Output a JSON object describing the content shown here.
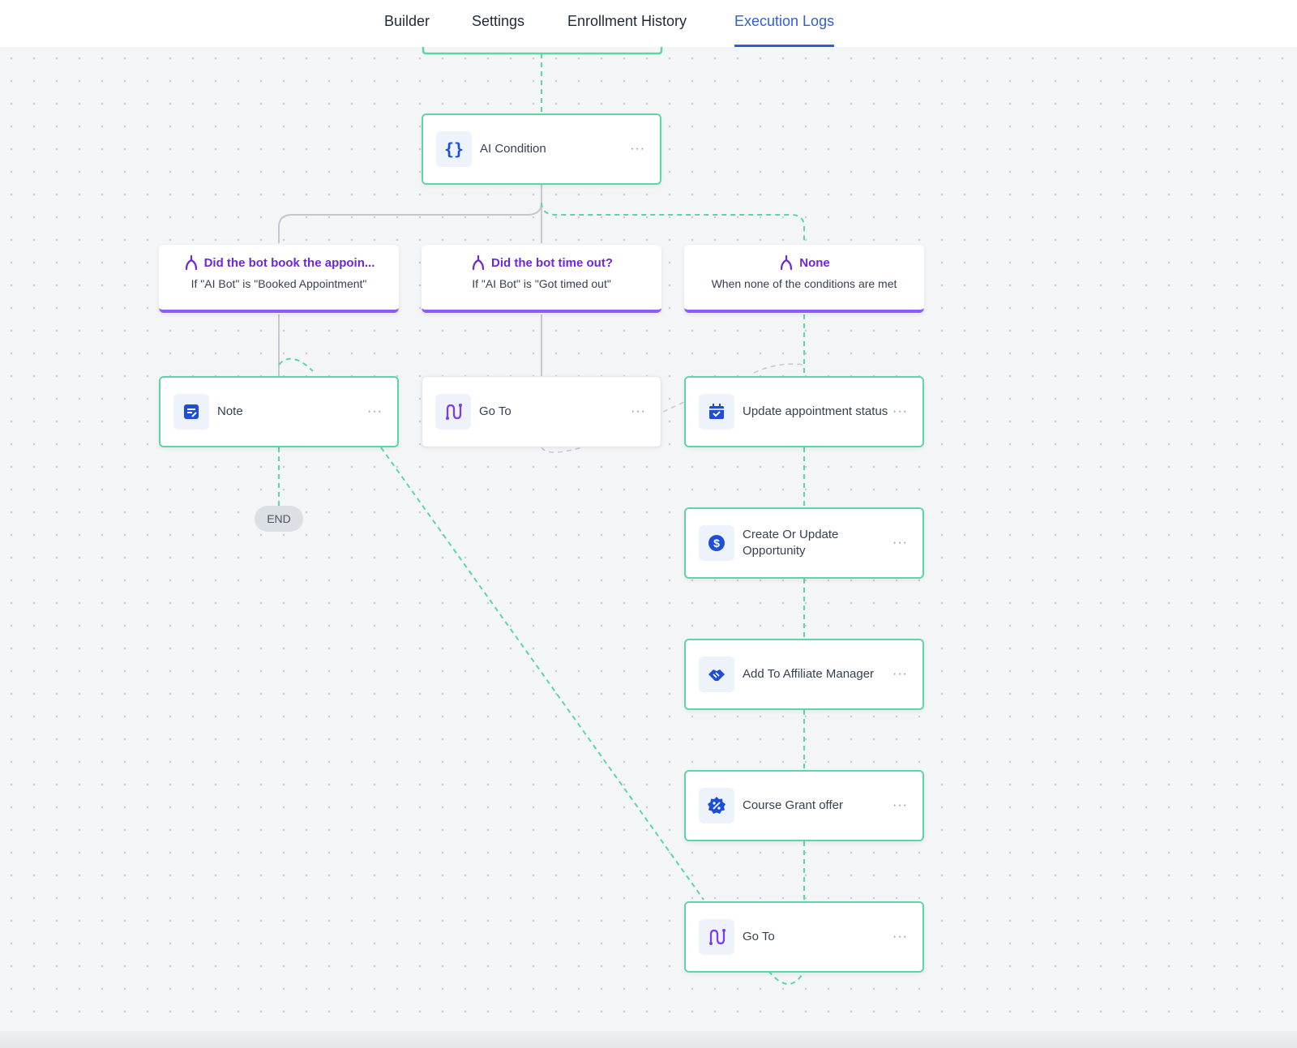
{
  "tabs": [
    {
      "label": "Builder"
    },
    {
      "label": "Settings"
    },
    {
      "label": "Enrollment History"
    },
    {
      "label": "Execution Logs"
    }
  ],
  "active_tab": "Execution Logs",
  "colors": {
    "accent": "#2f5fd0",
    "connector": "#5dd6a7",
    "branch": "#8b5cf6",
    "branch_title": "#6d28d9",
    "icon": "#1d4ed8"
  },
  "nodes": {
    "ai_condition": {
      "label": "AI Condition",
      "icon": "braces-icon",
      "more": "···"
    },
    "note": {
      "label": "Note",
      "icon": "note-icon",
      "more": "···"
    },
    "goto_middle": {
      "label": "Go To",
      "icon": "route-icon",
      "more": "···"
    },
    "update_appointment": {
      "label": "Update appointment status",
      "icon": "calendar-check-icon",
      "more": "···"
    },
    "opportunity": {
      "label": "Create Or Update Opportunity",
      "icon": "dollar-icon",
      "more": "···"
    },
    "affiliate": {
      "label": "Add To Affiliate Manager",
      "icon": "handshake-icon",
      "more": "···"
    },
    "course_grant": {
      "label": "Course Grant offer",
      "icon": "discount-badge-icon",
      "more": "···"
    },
    "goto_bottom": {
      "label": "Go To",
      "icon": "route-icon",
      "more": "···"
    }
  },
  "branches": [
    {
      "title": "Did the bot book the appoin...",
      "desc": "If \"AI Bot\" is \"Booked Appointment\"",
      "icon": "branch-icon"
    },
    {
      "title": "Did the bot time out?",
      "desc": "If \"AI Bot\" is \"Got timed out\"",
      "icon": "branch-icon"
    },
    {
      "title": "None",
      "desc": "When none of the conditions are met",
      "icon": "branch-icon"
    }
  ],
  "end_label": "END"
}
